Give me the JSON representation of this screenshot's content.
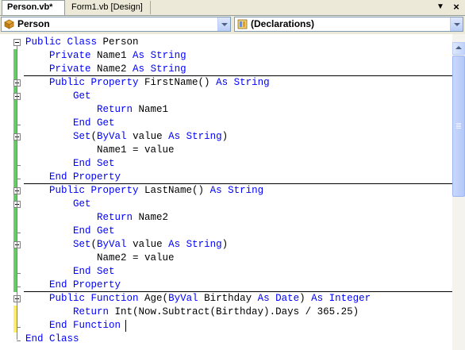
{
  "tabs": [
    {
      "label": "Person.vb*",
      "active": true
    },
    {
      "label": "Form1.vb [Design]",
      "active": false
    }
  ],
  "tab_controls": {
    "dropdown_icon": "chevron-down-icon",
    "close_icon": "close-icon",
    "close_glyph": "×",
    "dropdown_glyph": "▼"
  },
  "class_combo": {
    "value": "Person",
    "icon": "class-icon"
  },
  "member_combo": {
    "value": "(Declarations)",
    "icon": "declarations-icon"
  },
  "code": {
    "lines": [
      [
        [
          "kw",
          "Public "
        ],
        [
          "kw",
          "Class "
        ],
        [
          "t",
          "Person"
        ]
      ],
      [
        [
          "t",
          "    "
        ],
        [
          "kw",
          "Private "
        ],
        [
          "t",
          "Name1 "
        ],
        [
          "kw",
          "As "
        ],
        [
          "kw",
          "String"
        ]
      ],
      [
        [
          "t",
          "    "
        ],
        [
          "kw",
          "Private "
        ],
        [
          "t",
          "Name2 "
        ],
        [
          "kw",
          "As "
        ],
        [
          "kw",
          "String"
        ]
      ],
      [
        [
          "t",
          "    "
        ],
        [
          "kw",
          "Public "
        ],
        [
          "kw",
          "Property "
        ],
        [
          "t",
          "FirstName() "
        ],
        [
          "kw",
          "As "
        ],
        [
          "kw",
          "String"
        ]
      ],
      [
        [
          "t",
          "        "
        ],
        [
          "kw",
          "Get"
        ]
      ],
      [
        [
          "t",
          "            "
        ],
        [
          "kw",
          "Return "
        ],
        [
          "t",
          "Name1"
        ]
      ],
      [
        [
          "t",
          "        "
        ],
        [
          "kw",
          "End "
        ],
        [
          "kw",
          "Get"
        ]
      ],
      [
        [
          "t",
          "        "
        ],
        [
          "kw",
          "Set"
        ],
        [
          "t",
          "("
        ],
        [
          "kw",
          "ByVal "
        ],
        [
          "t",
          "value "
        ],
        [
          "kw",
          "As "
        ],
        [
          "kw",
          "String"
        ],
        [
          "t",
          ")"
        ]
      ],
      [
        [
          "t",
          "            Name1 = value"
        ]
      ],
      [
        [
          "t",
          "        "
        ],
        [
          "kw",
          "End "
        ],
        [
          "kw",
          "Set"
        ]
      ],
      [
        [
          "t",
          "    "
        ],
        [
          "kw",
          "End "
        ],
        [
          "kw",
          "Property"
        ]
      ],
      [
        [
          "t",
          "    "
        ],
        [
          "kw",
          "Public "
        ],
        [
          "kw",
          "Property "
        ],
        [
          "t",
          "LastName() "
        ],
        [
          "kw",
          "As "
        ],
        [
          "kw",
          "String"
        ]
      ],
      [
        [
          "t",
          "        "
        ],
        [
          "kw",
          "Get"
        ]
      ],
      [
        [
          "t",
          "            "
        ],
        [
          "kw",
          "Return "
        ],
        [
          "t",
          "Name2"
        ]
      ],
      [
        [
          "t",
          "        "
        ],
        [
          "kw",
          "End "
        ],
        [
          "kw",
          "Get"
        ]
      ],
      [
        [
          "t",
          "        "
        ],
        [
          "kw",
          "Set"
        ],
        [
          "t",
          "("
        ],
        [
          "kw",
          "ByVal "
        ],
        [
          "t",
          "value "
        ],
        [
          "kw",
          "As "
        ],
        [
          "kw",
          "String"
        ],
        [
          "t",
          ")"
        ]
      ],
      [
        [
          "t",
          "            Name2 = value"
        ]
      ],
      [
        [
          "t",
          "        "
        ],
        [
          "kw",
          "End "
        ],
        [
          "kw",
          "Set"
        ]
      ],
      [
        [
          "t",
          "    "
        ],
        [
          "kw",
          "End "
        ],
        [
          "kw",
          "Property"
        ]
      ],
      [
        [
          "t",
          "    "
        ],
        [
          "kw",
          "Public "
        ],
        [
          "kw",
          "Function "
        ],
        [
          "t",
          "Age("
        ],
        [
          "kw",
          "ByVal "
        ],
        [
          "t",
          "Birthday "
        ],
        [
          "kw",
          "As "
        ],
        [
          "kw",
          "Date"
        ],
        [
          "t",
          ") "
        ],
        [
          "kw",
          "As "
        ],
        [
          "kw",
          "Integer"
        ]
      ],
      [
        [
          "t",
          "        "
        ],
        [
          "kw",
          "Return "
        ],
        [
          "t",
          "Int(Now.Subtract(Birthday).Days / 365.25)"
        ]
      ],
      [
        [
          "t",
          "    "
        ],
        [
          "kw",
          "End "
        ],
        [
          "kw",
          "Function"
        ]
      ],
      [
        [
          "kw",
          "End "
        ],
        [
          "kw",
          "Class"
        ]
      ]
    ]
  },
  "colors": {
    "keyword": "#0000ff",
    "text": "#000000",
    "changed_marker": "#66cc66",
    "unsaved_marker": "#ffee66"
  }
}
